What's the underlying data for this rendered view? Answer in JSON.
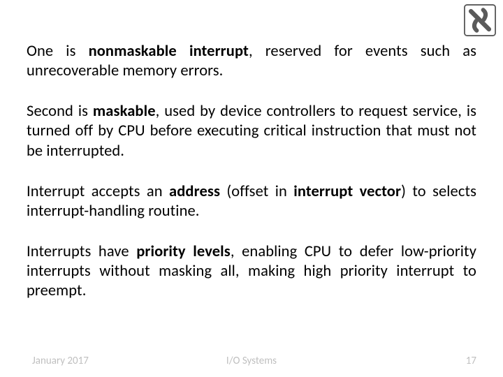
{
  "logo": {
    "name": "institution-logo"
  },
  "paragraphs": {
    "p1": {
      "t1": "One is ",
      "b1": "nonmaskable interrupt",
      "t2": ", reserved for events such as unrecoverable memory errors."
    },
    "p2": {
      "t1": "Second is ",
      "b1": "maskable",
      "t2": ", used by device controllers to request service, is turned off by CPU before executing critical instruction that must not be interrupted."
    },
    "p3": {
      "t1": "Interrupt accepts an ",
      "b1": "address",
      "t2": " (offset in ",
      "b2": "interrupt vector",
      "t3": ") to selects interrupt-handling routine."
    },
    "p4": {
      "t1": "Interrupts have ",
      "b1": "priority levels",
      "t2": ", enabling CPU to defer low-priority interrupts without masking all, making high priority interrupt to preempt."
    }
  },
  "footer": {
    "date": "January 2017",
    "title": "I/O Systems",
    "page": "17"
  }
}
